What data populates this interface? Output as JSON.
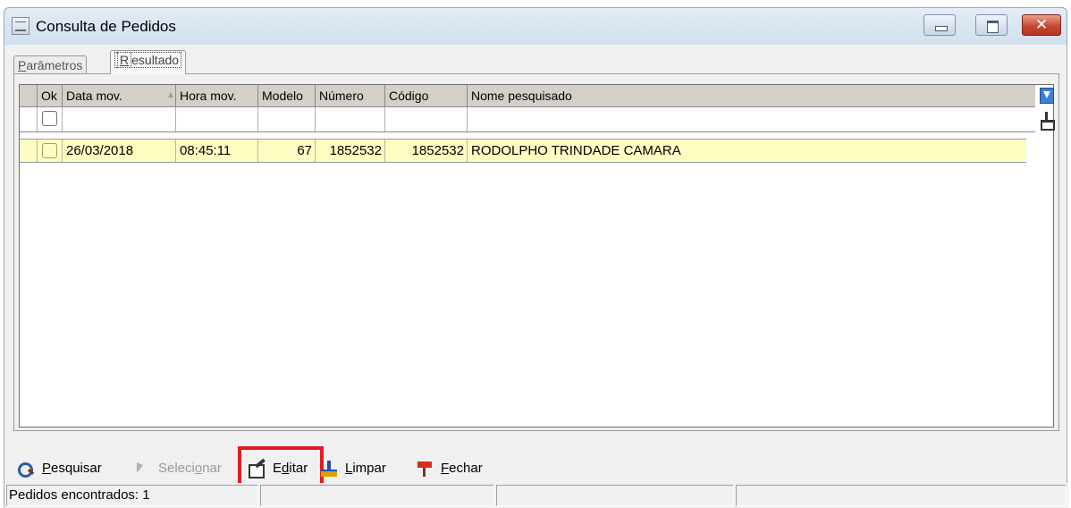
{
  "window": {
    "title": "Consulta de Pedidos",
    "close_glyph": "✕"
  },
  "tabs": [
    {
      "label": "Parâmetros",
      "active": false
    },
    {
      "label": "Resultado",
      "active": true
    }
  ],
  "grid": {
    "columns": [
      "Ok",
      "Data mov.",
      "Hora mov.",
      "Modelo",
      "Número",
      "Código",
      "Nome pesquisado"
    ],
    "rows": [
      {
        "ok": false,
        "data_mov": "26/03/2018",
        "hora_mov": "08:45:11",
        "modelo": "67",
        "numero": "1852532",
        "codigo": "1852532",
        "nome": "RODOLPHO TRINDADE CAMARA"
      }
    ]
  },
  "toolbar": {
    "pesquisar": {
      "label": "Pesquisar",
      "enabled": true
    },
    "selecionar": {
      "label": "Selecionar",
      "enabled": false
    },
    "editar": {
      "label": "Editar",
      "enabled": true,
      "highlighted": true
    },
    "limpar": {
      "label": "Limpar",
      "enabled": true
    },
    "fechar": {
      "label": "Fechar",
      "enabled": true
    }
  },
  "status": {
    "found_text": "Pedidos encontrados: 1"
  },
  "colors": {
    "highlight_border": "#e31b23",
    "selected_row": "#fdfdc2",
    "header_bg": "#d4d0c8"
  }
}
